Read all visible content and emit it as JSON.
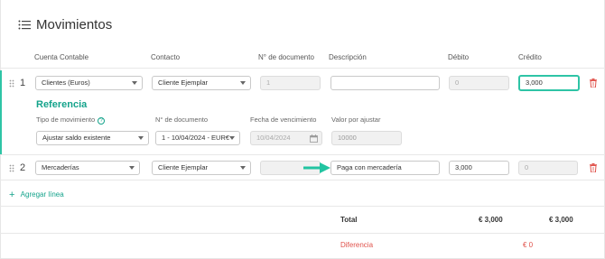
{
  "header": {
    "title": "Movimientos",
    "icon": "list-icon"
  },
  "columns": {
    "cuenta": "Cuenta Contable",
    "contacto": "Contacto",
    "documento": "N° de documento",
    "descripcion": "Descripción",
    "debito": "Débito",
    "credito": "Crédito"
  },
  "row1": {
    "num": "1",
    "cuenta": "Clientes (Euros)",
    "contacto": "Cliente Ejemplar",
    "documento": "1",
    "descripcion": "",
    "debito": "0",
    "credito": "3,000"
  },
  "referencia": {
    "title": "Referencia",
    "tipo_label": "Tipo de movimiento",
    "tipo_value": "Ajustar saldo existente",
    "doc_label": "N° de documento",
    "doc_value": "1 - 10/04/2024 - EUR€",
    "fecha_label": "Fecha de vencimiento",
    "fecha_value": "10/04/2024",
    "valor_label": "Valor por ajustar",
    "valor_value": "10000"
  },
  "row2": {
    "num": "2",
    "cuenta": "Mercaderías",
    "contacto": "Cliente Ejemplar",
    "documento": "",
    "descripcion": "Paga con mercadería",
    "debito": "3,000",
    "credito": "0"
  },
  "add_line": "Agregar línea",
  "totals": {
    "total_label": "Total",
    "total_debito": "€ 3,000",
    "total_credito": "€ 3,000",
    "diff_label": "Diferencia",
    "diff_value": "€ 0"
  },
  "colors": {
    "accent": "#2ec4a6",
    "danger": "#e0524b",
    "arrow": "#22c4a1"
  }
}
